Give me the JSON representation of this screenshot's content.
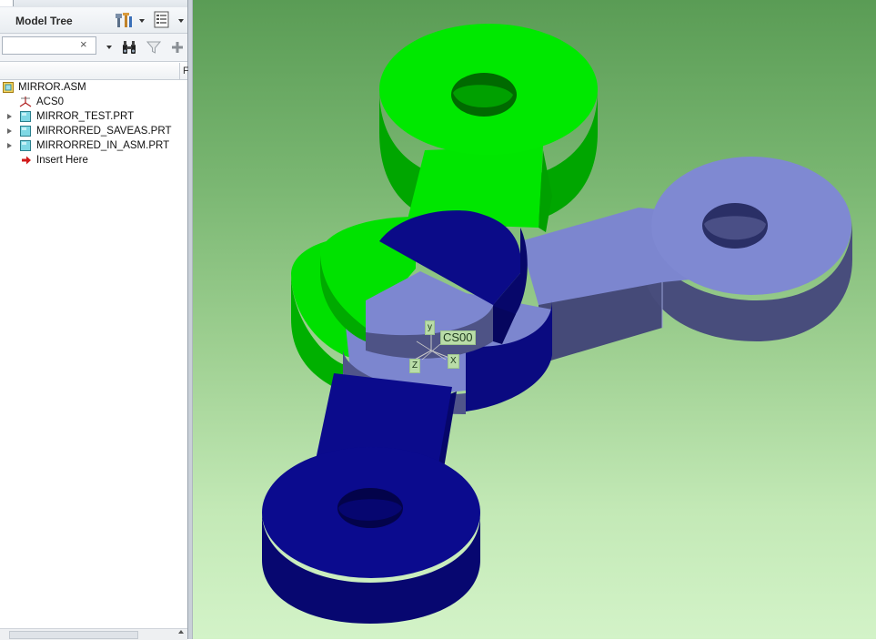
{
  "model_tree": {
    "title": "Model Tree",
    "search": {
      "value": "",
      "clear_icon": "×"
    },
    "column_letter": "F",
    "items": [
      {
        "label": "MIRROR.ASM",
        "icon": "assembly-icon",
        "expandable": false,
        "indent": 0
      },
      {
        "label": "ACS0",
        "icon": "csys-icon",
        "expandable": false,
        "indent": 1
      },
      {
        "label": "MIRROR_TEST.PRT",
        "icon": "part-icon",
        "expandable": true,
        "indent": 1
      },
      {
        "label": "MIRRORRED_SAVEAS.PRT",
        "icon": "part-icon",
        "expandable": true,
        "indent": 1
      },
      {
        "label": "MIRRORRED_IN_ASM.PRT",
        "icon": "part-icon",
        "expandable": true,
        "indent": 1
      },
      {
        "label": "Insert Here",
        "icon": "insert-arrow-icon",
        "expandable": false,
        "indent": 1
      }
    ],
    "toolbar_icons": [
      "settings-tools-icon",
      "tree-filters-icon",
      "binoculars-find-icon",
      "filter-icon",
      "add-column-icon"
    ]
  },
  "graphics": {
    "csys_name": "CS00",
    "axis_x": "X",
    "axis_y": "y",
    "axis_z": "Z",
    "colors": {
      "green_part": "#00e600",
      "green_part_side": "#00a400",
      "blue_part": "#0a0a8c",
      "blue_part_side": "#06066a",
      "lavender_part": "#7b86cf",
      "lavender_part_side": "#4a4f80"
    }
  }
}
